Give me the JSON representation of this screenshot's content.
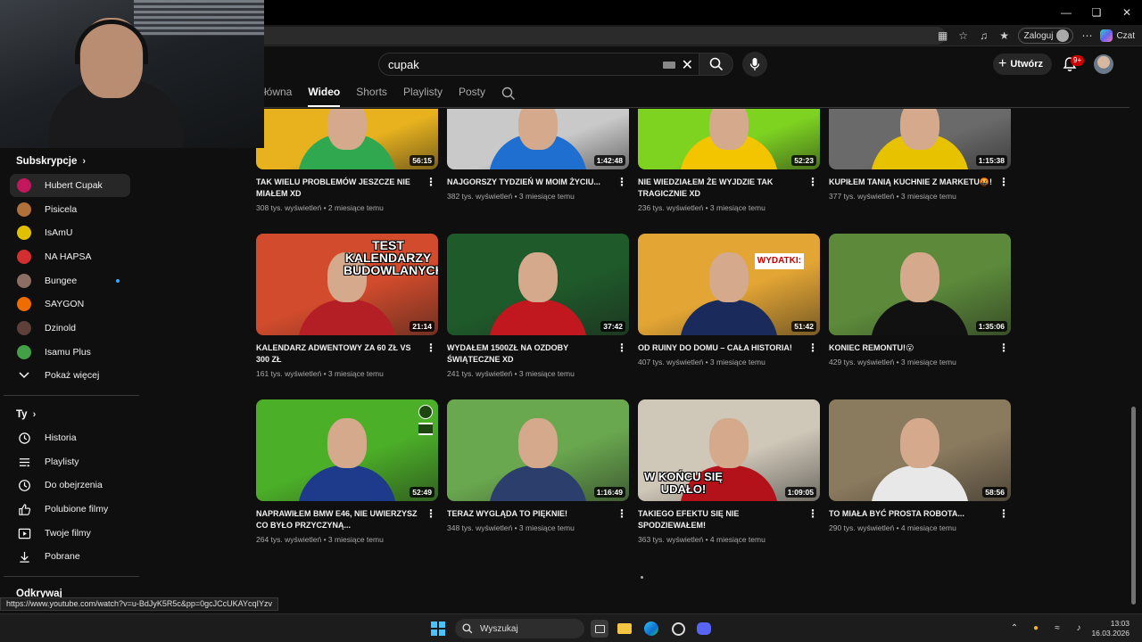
{
  "browser": {
    "login_label": "Zaloguj",
    "chat_label": "Czat"
  },
  "youtube": {
    "search_query": "cupak",
    "create_label": "Utwórz",
    "notifications_badge": "9+",
    "tabs": [
      "łówna",
      "Wideo",
      "Shorts",
      "Playlisty",
      "Posty"
    ],
    "active_tab": "Wideo"
  },
  "sidebar": {
    "subscriptions_heading": "Subskrypcje",
    "subscriptions": [
      {
        "label": "Hubert Cupak",
        "color": "#c2185b",
        "active": true
      },
      {
        "label": "Pisicela",
        "color": "#b0703a"
      },
      {
        "label": "IsAmU",
        "color": "#e0c000"
      },
      {
        "label": "NA HAPSA",
        "color": "#d32f2f"
      },
      {
        "label": "Bungee",
        "color": "#8d6e63",
        "new_content": true
      },
      {
        "label": "SAYGON",
        "color": "#ef6c00"
      },
      {
        "label": "Dzinold",
        "color": "#5d4037"
      },
      {
        "label": "Isamu Plus",
        "color": "#43a047"
      }
    ],
    "show_more_label": "Pokaż więcej",
    "you_heading": "Ty",
    "you_items": [
      {
        "label": "Historia",
        "icon": "history-icon"
      },
      {
        "label": "Playlisty",
        "icon": "playlists-icon"
      },
      {
        "label": "Do obejrzenia",
        "icon": "watch-later-icon"
      },
      {
        "label": "Polubione filmy",
        "icon": "like-icon"
      },
      {
        "label": "Twoje filmy",
        "icon": "your-videos-icon"
      },
      {
        "label": "Pobrane",
        "icon": "download-icon"
      }
    ],
    "explore_heading": "Odkrywaj"
  },
  "videos": [
    {
      "title": "TAK WIELU PROBLEMÓW JESZCZE NIE MIAŁEM XD",
      "meta": "308 tys. wyświetleń • 2 miesiące temu",
      "duration": "56:15",
      "bg": "#e7b21e",
      "shirt": "#2fa84f"
    },
    {
      "title": "NAJGORSZY TYDZIEŃ W MOIM ŻYCIU...",
      "meta": "382 tys. wyświetleń • 3 miesiące temu",
      "duration": "1:42:48",
      "bg": "#c9c9c9",
      "shirt": "#1f6fd1"
    },
    {
      "title": "NIE WIEDZIAŁEM ŻE WYJDZIE TAK TRAGICZNIE XD",
      "meta": "236 tys. wyświetleń • 3 miesiące temu",
      "duration": "52:23",
      "bg": "#7ed321",
      "shirt": "#f2c500"
    },
    {
      "title": "KUPIŁEM TANIĄ KUCHNIE Z MARKETU🤬!",
      "meta": "377 tys. wyświetleń • 3 miesiące temu",
      "duration": "1:15:38",
      "bg": "#6a6a6a",
      "shirt": "#e6c200"
    },
    {
      "title": "KALENDARZ ADWENTOWY ZA 60 ZŁ VS 300 ZŁ",
      "meta": "161 tys. wyświetleń • 3 miesiące temu",
      "duration": "21:14",
      "bg": "#d24b2c",
      "shirt": "#b31f24",
      "overlay": "TEST KALENDARZY BUDOWLANYCH"
    },
    {
      "title": "WYDAŁEM 1500ZŁ NA OZDOBY ŚWIĄTECZNE XD",
      "meta": "241 tys. wyświetleń • 3 miesiące temu",
      "duration": "37:42",
      "bg": "#1f5a2a",
      "shirt": "#c0181e"
    },
    {
      "title": "OD RUINY DO DOMU – CAŁA HISTORIA!",
      "meta": "407 tys. wyświetleń • 3 miesiące temu",
      "duration": "51:42",
      "bg": "#e3a534",
      "shirt": "#1a2a5a",
      "overlay": "WYDATKI:"
    },
    {
      "title": "KONIEC REMONTU!😮",
      "meta": "429 tys. wyświetleń • 3 miesiące temu",
      "duration": "1:35:06",
      "bg": "#5c8a3a",
      "shirt": "#111111"
    },
    {
      "title": "NAPRAWIŁEM BMW E46, NIE UWIERZYSZ CO BYŁO PRZYCZYNĄ...",
      "meta": "264 tys. wyświetleń • 3 miesiące temu",
      "duration": "52:49",
      "bg": "#4caf28",
      "shirt": "#1e3a8a"
    },
    {
      "title": "TERAZ WYGLĄDA TO PIĘKNIE!",
      "meta": "348 tys. wyświetleń • 3 miesiące temu",
      "duration": "1:16:49",
      "bg": "#6aa84f",
      "shirt": "#2c3e6b"
    },
    {
      "title": "TAKIEGO EFEKTU SIĘ NIE SPODZIEWAŁEM!",
      "meta": "363 tys. wyświetleń • 4 miesiące temu",
      "duration": "1:09:05",
      "bg": "#cfc7b8",
      "shirt": "#b3121a",
      "overlay": "W KOŃCU SIĘ UDAŁO!"
    },
    {
      "title": "TO MIAŁA BYĆ PROSTA ROBOTA...",
      "meta": "290 tys. wyświetleń • 4 miesiące temu",
      "duration": "58:56",
      "bg": "#8a7a5e",
      "shirt": "#e8e8e8"
    }
  ],
  "status_url": "https://www.youtube.com/watch?v=u-BdJyK5R5c&pp=0gcJCcUKAYcqIYzv",
  "taskbar": {
    "search_label": "Wyszukaj",
    "time": "13:03",
    "date": "16.03.2026"
  }
}
